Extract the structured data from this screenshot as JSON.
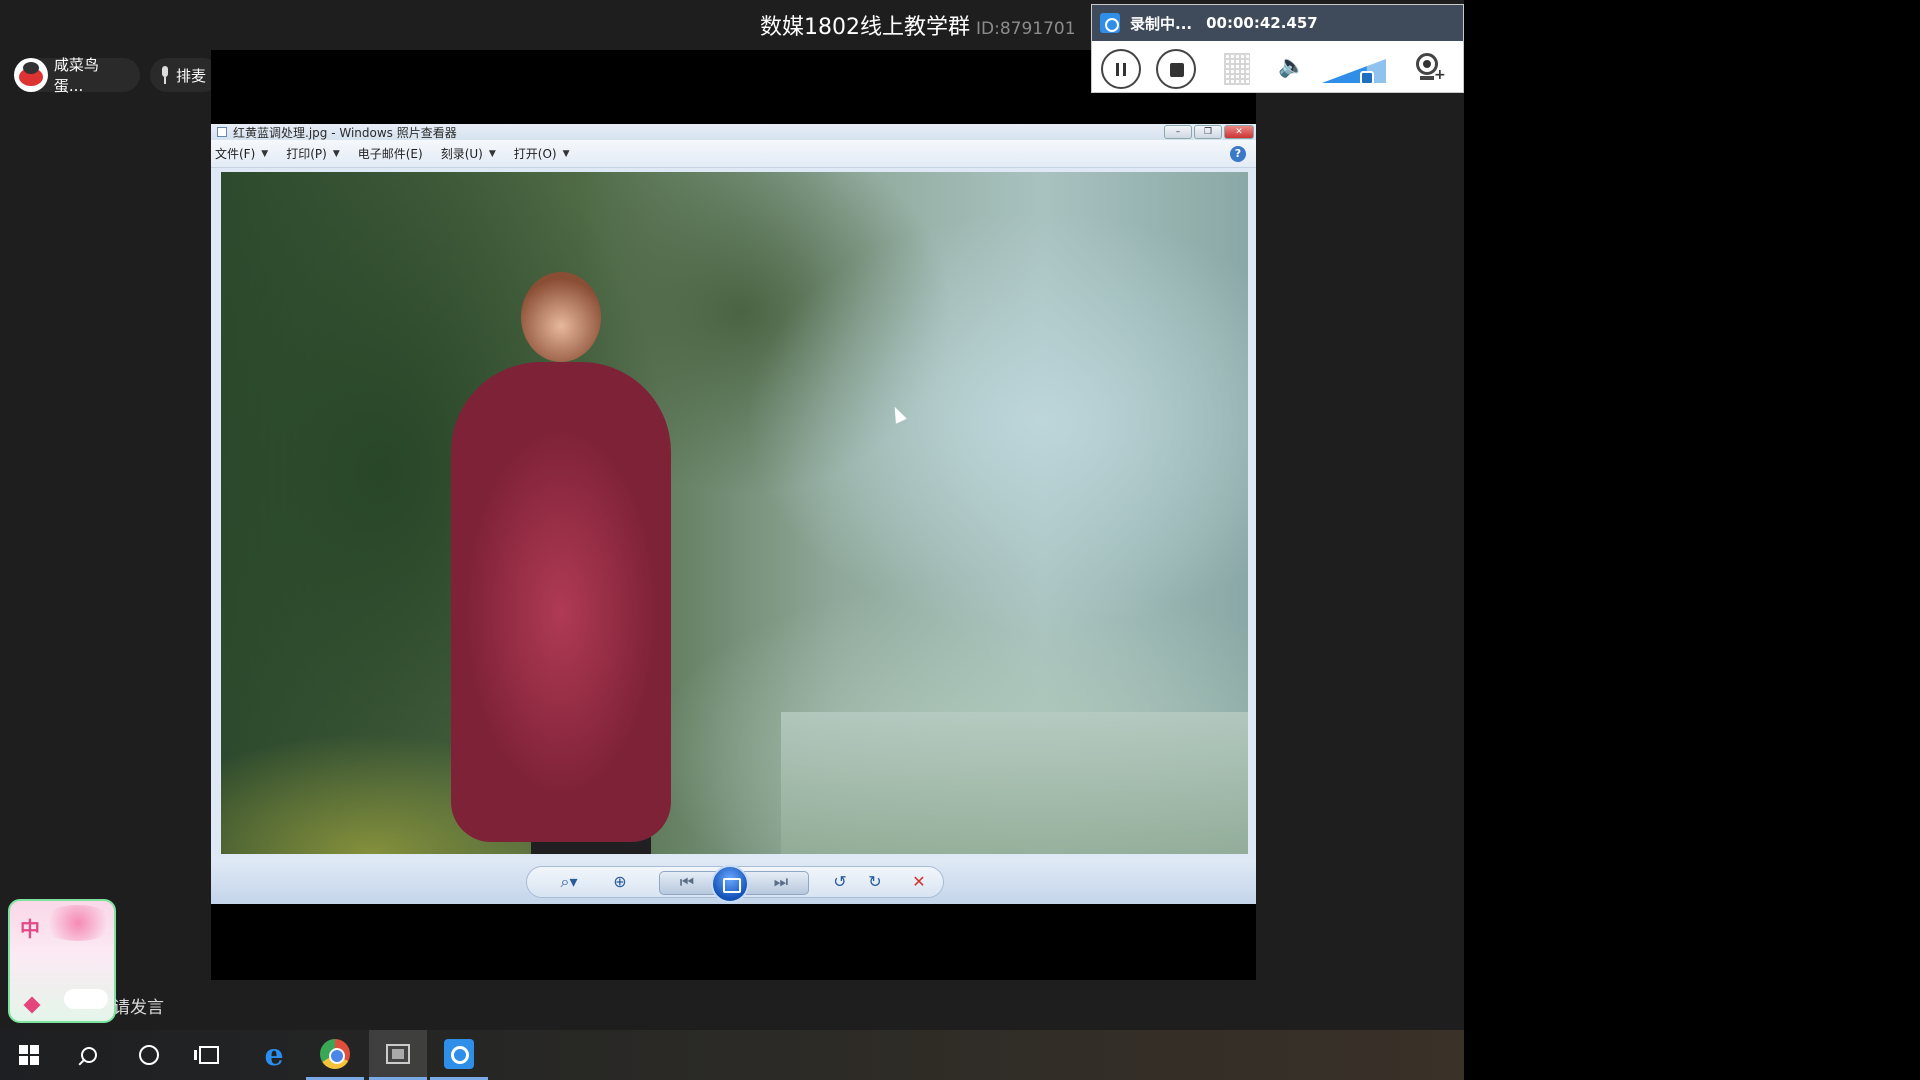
{
  "header": {
    "group_name": "数媒1802线上教学群",
    "group_id": "ID:8791701"
  },
  "participants": {
    "user_name": "咸菜鸟蛋...",
    "queue_label": "排麦"
  },
  "viewer": {
    "title": "红黄蓝调处理.jpg - Windows 照片查看器",
    "menu": [
      {
        "label": "文件(F)",
        "has_dropdown": true
      },
      {
        "label": "打印(P)",
        "has_dropdown": true
      },
      {
        "label": "电子邮件(E)",
        "has_dropdown": false
      },
      {
        "label": "刻录(U)",
        "has_dropdown": true
      },
      {
        "label": "打开(O)",
        "has_dropdown": true
      }
    ],
    "help_glyph": "?",
    "icons": {
      "zoom": "zoom-icon",
      "fit": "actual-size-icon",
      "prev": "previous-icon",
      "slideshow": "slideshow-icon",
      "next": "next-icon",
      "rotate_left": "rotate-left-icon",
      "rotate_right": "rotate-right-icon",
      "delete": "delete-icon"
    }
  },
  "recorder": {
    "status": "录制中...",
    "timer": "00:00:42.457",
    "volume_level": 0.7,
    "accent": "#2f8ee8"
  },
  "sticker": {
    "char": "中"
  },
  "speak_request": "请发言",
  "taskbar": {
    "apps": [
      "start",
      "search",
      "cortana",
      "task-view",
      "edge",
      "chrome",
      "photo-viewer",
      "screen-recorder"
    ]
  },
  "colors": {
    "background": "#1e1e1e",
    "viewer_chrome": "#dfe9f5",
    "delete_red": "#d0342c"
  }
}
